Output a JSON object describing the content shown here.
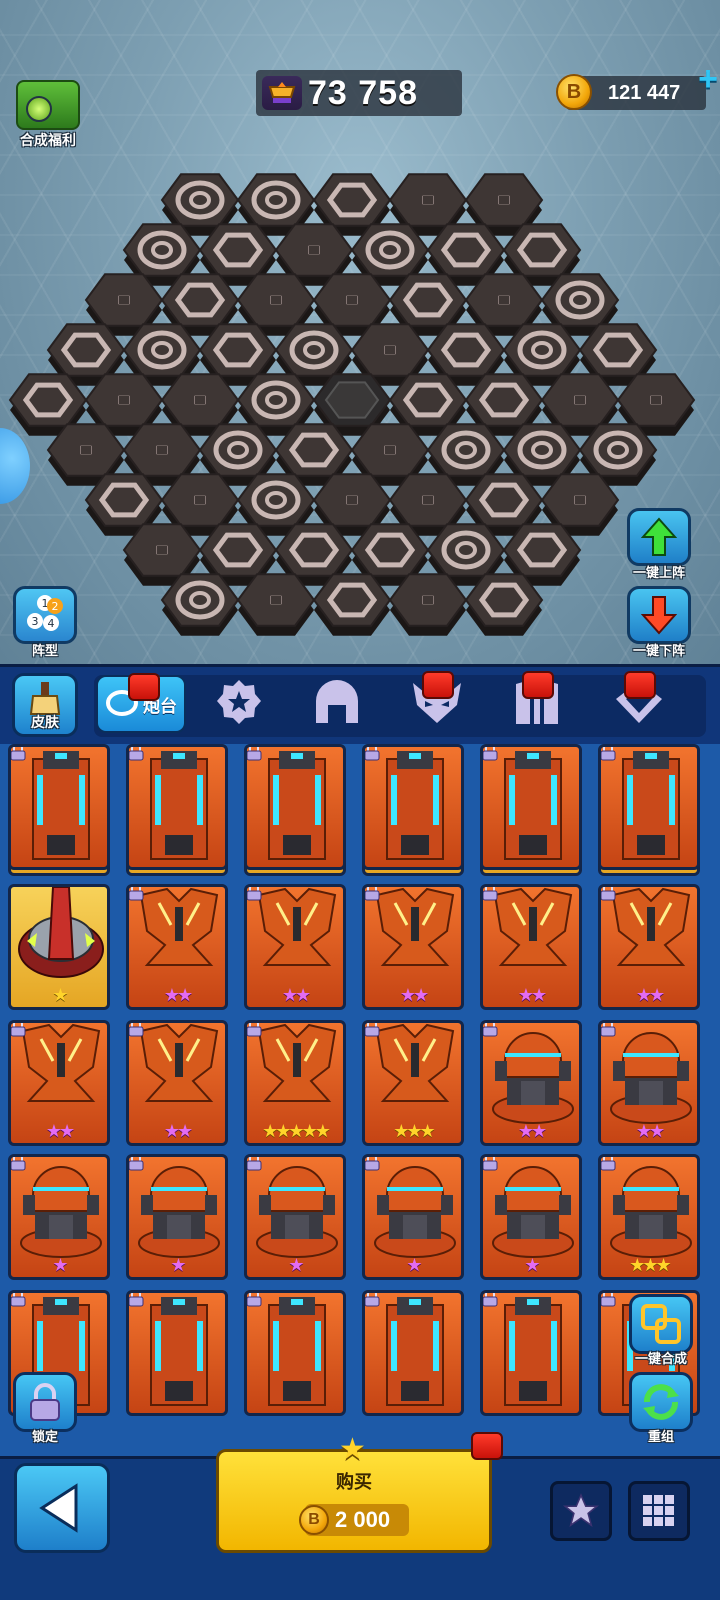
{
  "header": {
    "trophy_value": "73 758",
    "coin_value": "121 447",
    "coin_symbol": "B",
    "synth_benefit_label": "合成福利"
  },
  "board": {
    "rows": [
      [
        "target",
        "target",
        "hex",
        "check",
        "check"
      ],
      [
        "target",
        "hex",
        "check",
        "target",
        "hex",
        "hex"
      ],
      [
        "check",
        "hex",
        "check",
        "check",
        "hex",
        "check",
        "target"
      ],
      [
        "hex",
        "target",
        "hex",
        "target",
        "check",
        "hex",
        "target",
        "hex"
      ],
      [
        "hex",
        "check",
        "check",
        "target",
        "center",
        "hex",
        "hex",
        "check",
        "check"
      ],
      [
        "check",
        "check",
        "target",
        "hex",
        "check",
        "target",
        "target",
        "target"
      ],
      [
        "hex",
        "check",
        "target",
        "check",
        "check",
        "hex",
        "check"
      ],
      [
        "check",
        "hex",
        "hex",
        "hex",
        "target",
        "hex"
      ],
      [
        "target",
        "check",
        "hex",
        "check",
        "hex"
      ]
    ]
  },
  "side_buttons": {
    "formation": "阵型",
    "up": "一键上阵",
    "down": "一键下阵"
  },
  "tabs": {
    "skin": "皮肤",
    "items": [
      {
        "icon": "turret-base-icon",
        "label": "炮台",
        "active": true,
        "notify": true
      },
      {
        "icon": "gear-star-icon",
        "label": "",
        "active": false,
        "notify": false
      },
      {
        "icon": "helmet-icon",
        "label": "",
        "active": false,
        "notify": false
      },
      {
        "icon": "demon-mask-icon",
        "label": "",
        "active": false,
        "notify": true
      },
      {
        "icon": "claw-icon",
        "label": "",
        "active": false,
        "notify": true
      },
      {
        "icon": "diamond-icon",
        "label": "",
        "active": false,
        "notify": true
      }
    ]
  },
  "cards": [
    {
      "type": "red-mech",
      "bg": "gold",
      "stars": "★",
      "star_color": "gold",
      "locked": true
    },
    {
      "type": "red-mech",
      "bg": "gold",
      "stars": "★",
      "star_color": "gold",
      "locked": true
    },
    {
      "type": "red-cannon",
      "bg": "gold",
      "stars": "★★",
      "star_color": "gold",
      "locked": true
    },
    {
      "type": "red-cannon",
      "bg": "gold",
      "stars": "★",
      "star_color": "gold",
      "locked": true
    },
    {
      "type": "red-cannon",
      "bg": "gold",
      "stars": "★",
      "star_color": "gold",
      "locked": true
    },
    {
      "type": "red-cannon",
      "bg": "gold",
      "stars": "★",
      "star_color": "gold",
      "locked": true
    },
    {
      "type": "red-cannon",
      "bg": "gold",
      "stars": "★",
      "star_color": "gold",
      "locked": false
    },
    {
      "type": "orange-heart",
      "bg": "orange",
      "stars": "★★",
      "star_color": "purple",
      "locked": true
    },
    {
      "type": "orange-heart",
      "bg": "orange",
      "stars": "★★",
      "star_color": "purple",
      "locked": true
    },
    {
      "type": "orange-heart",
      "bg": "orange",
      "stars": "★★",
      "star_color": "purple",
      "locked": true
    },
    {
      "type": "orange-heart",
      "bg": "orange",
      "stars": "★★",
      "star_color": "purple",
      "locked": true
    },
    {
      "type": "orange-heart",
      "bg": "orange",
      "stars": "★★",
      "star_color": "purple",
      "locked": true
    },
    {
      "type": "orange-heart",
      "bg": "orange",
      "stars": "★★",
      "star_color": "purple",
      "locked": true
    },
    {
      "type": "orange-heart",
      "bg": "orange",
      "stars": "★★",
      "star_color": "purple",
      "locked": true
    },
    {
      "type": "orange-heart",
      "bg": "orange",
      "stars": "★★★★★",
      "star_color": "gold",
      "locked": true
    },
    {
      "type": "orange-heart",
      "bg": "orange",
      "stars": "★★★",
      "star_color": "gold",
      "locked": true
    },
    {
      "type": "orange-dome",
      "bg": "orange",
      "stars": "★★",
      "star_color": "purple",
      "locked": true
    },
    {
      "type": "orange-dome",
      "bg": "orange",
      "stars": "★★",
      "star_color": "purple",
      "locked": true
    },
    {
      "type": "orange-dome",
      "bg": "orange",
      "stars": "★",
      "star_color": "purple",
      "locked": true
    },
    {
      "type": "orange-dome",
      "bg": "orange",
      "stars": "★",
      "star_color": "purple",
      "locked": true
    },
    {
      "type": "orange-dome",
      "bg": "orange",
      "stars": "★",
      "star_color": "purple",
      "locked": true
    },
    {
      "type": "orange-dome",
      "bg": "orange",
      "stars": "★",
      "star_color": "purple",
      "locked": true
    },
    {
      "type": "orange-dome",
      "bg": "orange",
      "stars": "★",
      "star_color": "purple",
      "locked": true
    },
    {
      "type": "orange-dome",
      "bg": "orange",
      "stars": "★★★",
      "star_color": "gold",
      "locked": true
    },
    {
      "type": "orange-tower",
      "bg": "orange",
      "stars": "",
      "star_color": "purple",
      "locked": true
    },
    {
      "type": "orange-tower",
      "bg": "orange",
      "stars": "",
      "star_color": "purple",
      "locked": true
    },
    {
      "type": "orange-tower",
      "bg": "orange",
      "stars": "",
      "star_color": "purple",
      "locked": true
    },
    {
      "type": "orange-tower",
      "bg": "orange",
      "stars": "",
      "star_color": "purple",
      "locked": true
    },
    {
      "type": "orange-tower",
      "bg": "orange",
      "stars": "",
      "star_color": "purple",
      "locked": true
    },
    {
      "type": "orange-tower",
      "bg": "orange",
      "stars": "",
      "star_color": "purple",
      "locked": true
    },
    {
      "type": "orange-tower",
      "bg": "orange",
      "stars": "",
      "star_color": "purple",
      "locked": true
    },
    {
      "type": "orange-tower",
      "bg": "orange",
      "stars": "",
      "star_color": "purple",
      "locked": true
    },
    {
      "type": "orange-tower",
      "bg": "orange",
      "stars": "",
      "star_color": "purple",
      "locked": true
    },
    {
      "type": "orange-tower",
      "bg": "orange",
      "stars": "",
      "star_color": "purple",
      "locked": true
    },
    {
      "type": "orange-tower",
      "bg": "orange",
      "stars": "",
      "star_color": "purple",
      "locked": true
    },
    {
      "type": "orange-tower",
      "bg": "orange",
      "stars": "",
      "star_color": "purple",
      "locked": true
    }
  ],
  "floating": {
    "onekey_merge": "一键合成",
    "regroup": "重组",
    "lock": "锁定"
  },
  "bottom": {
    "buy_label": "购买",
    "price": "2 000"
  },
  "colors": {
    "panel_blue": "#1d5aa8",
    "tab_active": "#2aa6ea",
    "gold": "#f7d25a",
    "orange": "#f2742e"
  }
}
